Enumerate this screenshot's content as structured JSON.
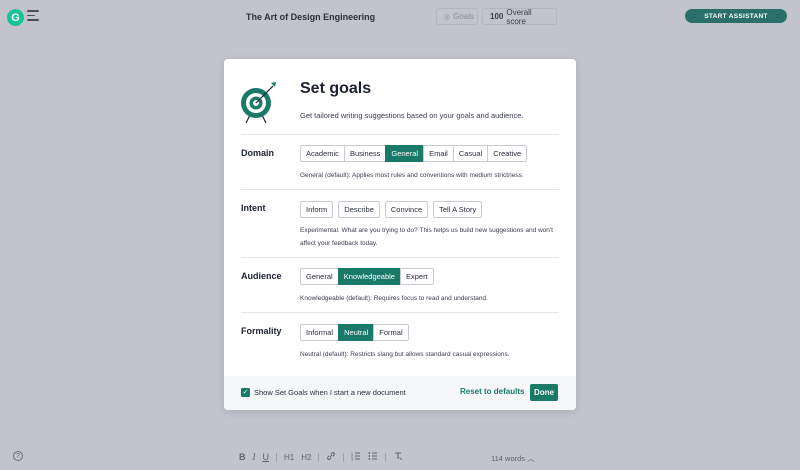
{
  "app": {
    "logo_letter": "G",
    "document_title": "The Art of Design Engineering"
  },
  "header": {
    "goals_label": "Goals",
    "score_value": "100",
    "score_label": "Overall score",
    "assistant_label": "START ASSISTANT"
  },
  "modal": {
    "title": "Set goals",
    "subtitle": "Get tailored writing suggestions based on your goals and audience.",
    "domain": {
      "label": "Domain",
      "options": [
        "Academic",
        "Business",
        "General",
        "Email",
        "Casual",
        "Creative"
      ],
      "selected": "General",
      "description": "General (default): Applies most rules and conventions with medium strictness."
    },
    "intent": {
      "label": "Intent",
      "options": [
        "Inform",
        "Describe",
        "Convince",
        "Tell A Story"
      ],
      "description": "Experimental. What are you trying to do? This helps us build new suggestions and won't affect your feedback today."
    },
    "audience": {
      "label": "Audience",
      "options": [
        "General",
        "Knowledgeable",
        "Expert"
      ],
      "selected": "Knowledgeable",
      "description": "Knowledgeable (default): Requires focus to read and understand."
    },
    "formality": {
      "label": "Formality",
      "options": [
        "Informal",
        "Neutral",
        "Formal"
      ],
      "selected": "Neutral",
      "description": "Neutral (default): Restricts slang but allows standard casual expressions."
    },
    "footer": {
      "checkbox_checked": true,
      "checkbox_label": "Show Set Goals when I start a new document",
      "reset_label": "Reset to defaults",
      "done_label": "Done"
    }
  },
  "editor": {
    "toolbar": [
      "B",
      "I",
      "U",
      "H1",
      "H2",
      "link",
      "ordered-list",
      "bullet-list",
      "clear-format"
    ],
    "word_count": "114 words"
  },
  "colors": {
    "accent": "#1a7a6a",
    "brand": "#15c39a",
    "assistant": "#2b6f6b",
    "backdrop": "#c2c3cc"
  },
  "icons": [
    "grammarly-logo-icon",
    "menu-icon",
    "goals-icon",
    "target-icon",
    "help-icon",
    "chevron-up-icon"
  ]
}
